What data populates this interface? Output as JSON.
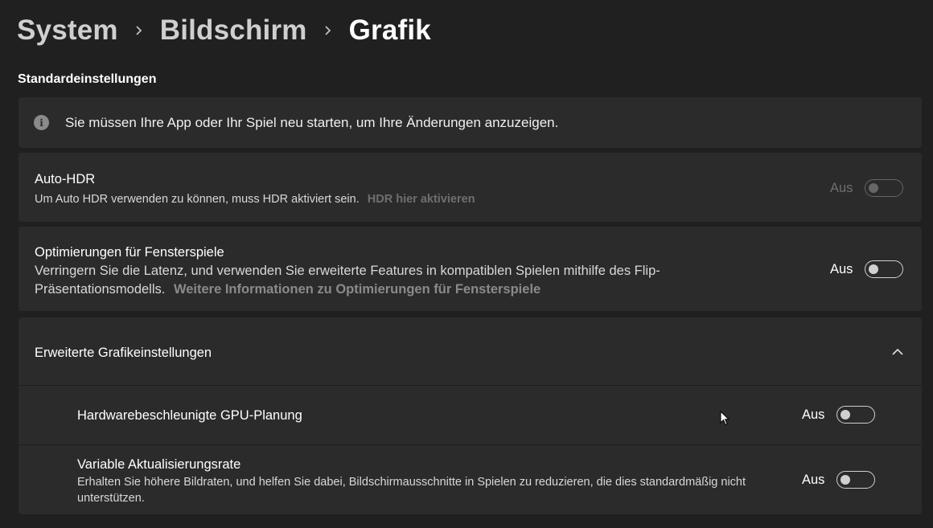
{
  "breadcrumb": {
    "items": [
      "System",
      "Bildschirm",
      "Grafik"
    ]
  },
  "section_title": "Standardeinstellungen",
  "info": {
    "text": "Sie müssen Ihre App oder Ihr Spiel neu starten, um Ihre Änderungen anzuzeigen."
  },
  "auto_hdr": {
    "title": "Auto-HDR",
    "description": "Um Auto HDR verwenden zu können, muss HDR aktiviert sein.",
    "link": "HDR hier aktivieren",
    "state_label": "Aus",
    "enabled": false,
    "on": false
  },
  "windowed_games": {
    "title": "Optimierungen für Fensterspiele",
    "description_line1": "Verringern Sie die Latenz, und verwenden Sie erweiterte Features in kompatiblen Spielen mithilfe des Flip-",
    "description_line2": "Präsentationsmodells.",
    "link": "Weitere Informationen zu Optimierungen für Fensterspiele",
    "state_label": "Aus",
    "on": false
  },
  "advanced": {
    "title": "Erweiterte Grafikeinstellungen",
    "expanded": true,
    "gpu_scheduling": {
      "title": "Hardwarebeschleunigte GPU-Planung",
      "state_label": "Aus",
      "on": false
    },
    "vrr": {
      "title": "Variable Aktualisierungsrate",
      "description": "Erhalten Sie höhere Bildraten, und helfen Sie dabei, Bildschirmausschnitte in Spielen zu reduzieren, die dies standardmäßig nicht unterstützen.",
      "state_label": "Aus",
      "on": false
    }
  },
  "colors": {
    "background": "#202020",
    "card": "#2b2b2b",
    "link_gray": "#8a8a8a",
    "toggle_border": "#d0d0d0",
    "disabled": "#6f6f6f"
  }
}
